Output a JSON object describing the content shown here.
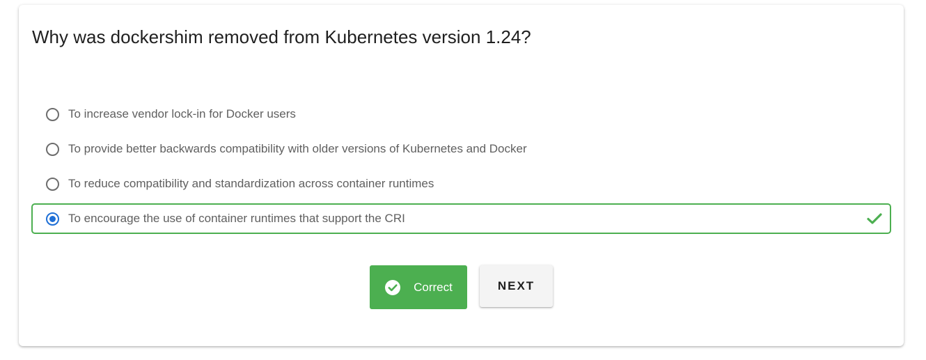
{
  "question": {
    "text": "Why was dockershim removed from Kubernetes version 1.24?"
  },
  "options": [
    {
      "label": "To increase vendor lock-in for Docker users",
      "selected": false,
      "correct": false
    },
    {
      "label": "To provide better backwards compatibility with older versions of Kubernetes and Docker",
      "selected": false,
      "correct": false
    },
    {
      "label": "To reduce compatibility and standardization across container runtimes",
      "selected": false,
      "correct": false
    },
    {
      "label": "To encourage the use of container runtimes that support the CRI",
      "selected": true,
      "correct": true
    }
  ],
  "result": {
    "label": "Correct",
    "icon": "check-circle-icon"
  },
  "next_button": {
    "label": "NEXT"
  },
  "colors": {
    "success": "#4caf50",
    "radio_selected": "#1e6fd6",
    "text_muted": "#5f5f5f"
  }
}
